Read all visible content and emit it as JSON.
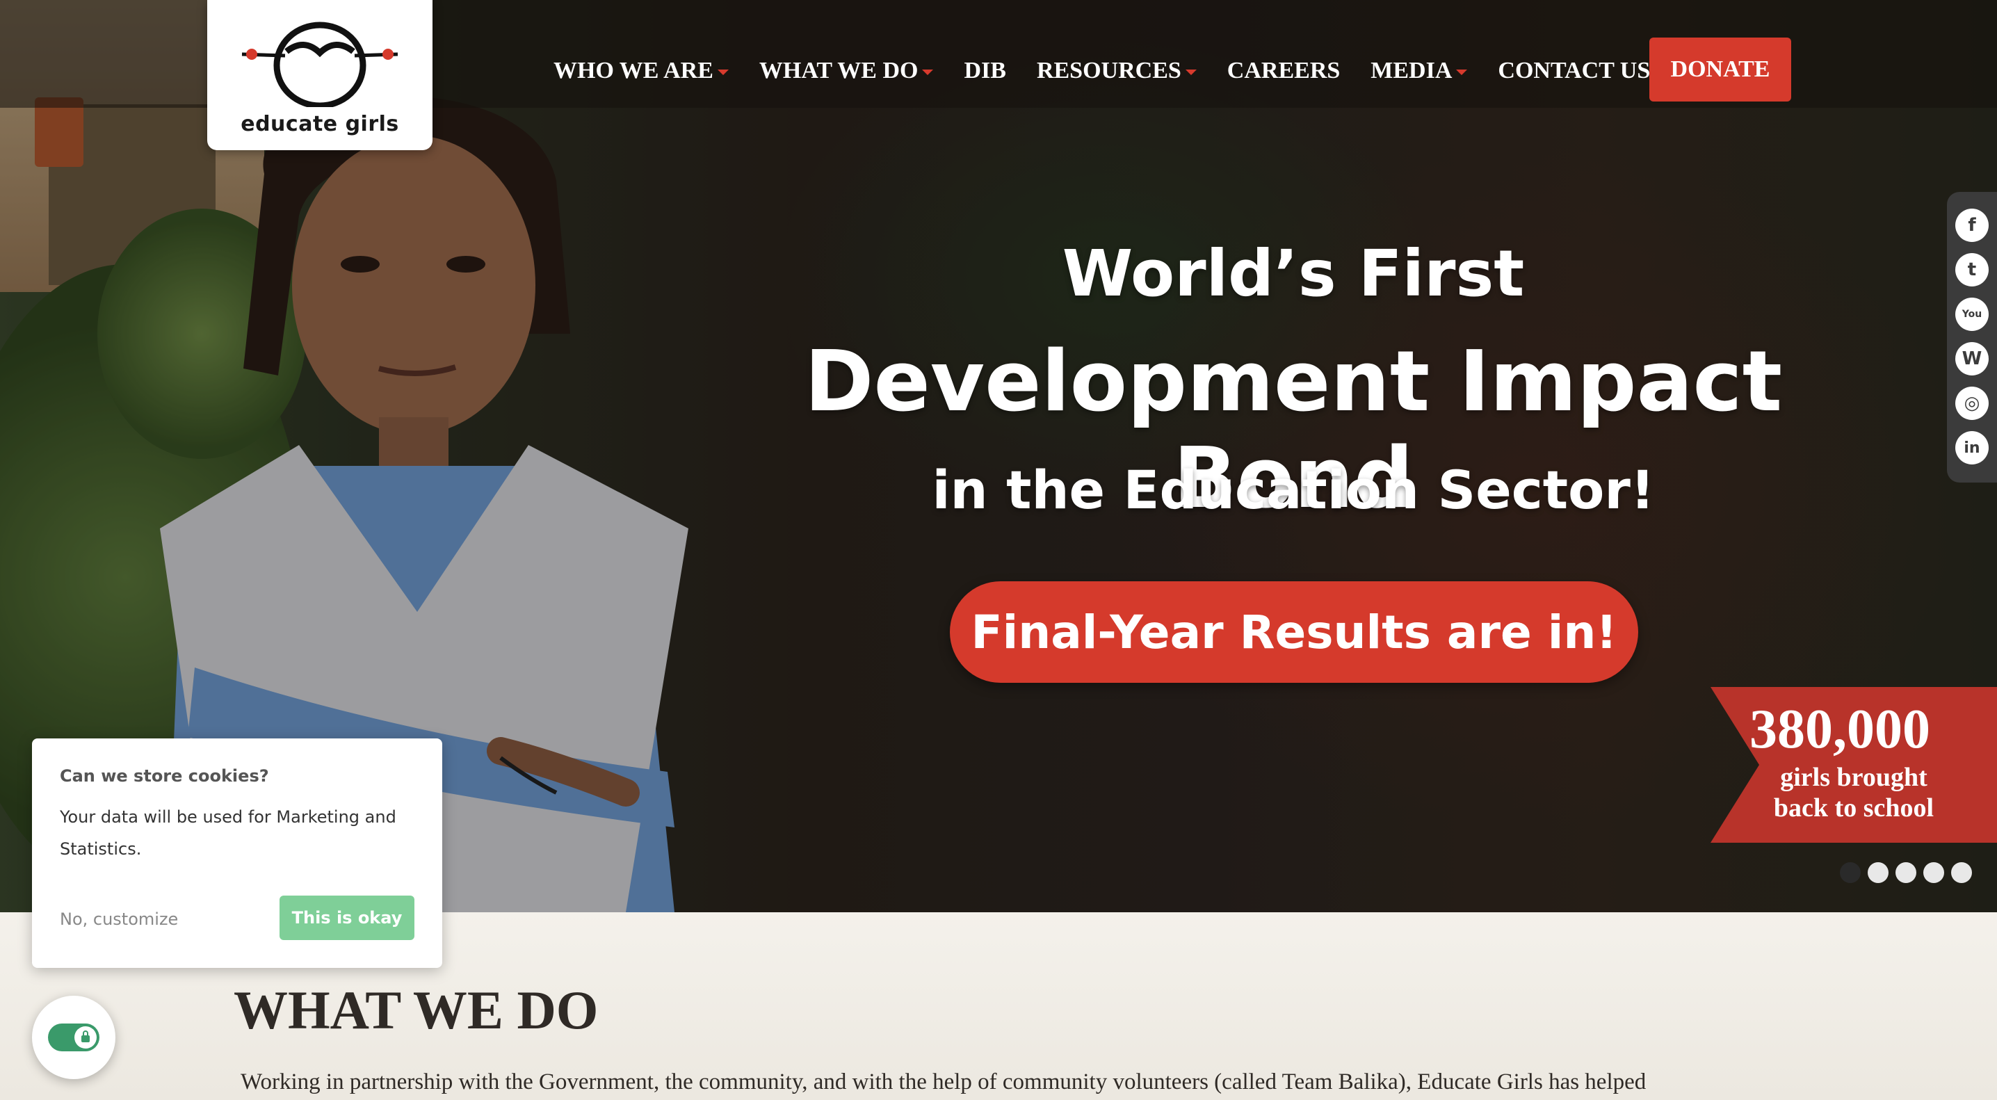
{
  "brand": {
    "name": "educate girls",
    "accent": "#d53a2c"
  },
  "nav": {
    "items": [
      {
        "label": "WHO WE ARE",
        "dropdown": true
      },
      {
        "label": "WHAT WE DO",
        "dropdown": true
      },
      {
        "label": "DIB",
        "dropdown": false
      },
      {
        "label": "RESOURCES",
        "dropdown": true
      },
      {
        "label": "CAREERS",
        "dropdown": false
      },
      {
        "label": "MEDIA",
        "dropdown": true
      },
      {
        "label": "CONTACT US",
        "dropdown": false
      }
    ],
    "donate_label": "DONATE"
  },
  "hero": {
    "line1": "World’s First",
    "line2": "Development Impact Bond",
    "line3": "in the Education Sector!",
    "cta_label": "Final-Year Results are in!",
    "stat_number": "380,000",
    "stat_caption_1": "girls brought",
    "stat_caption_2": "back to school",
    "slides_total": 5,
    "active_slide": 1
  },
  "social": {
    "icons": [
      "facebook-icon",
      "twitter-icon",
      "youtube-icon",
      "wordpress-icon",
      "instagram-icon",
      "linkedin-icon"
    ],
    "glyphs": [
      "f",
      "t",
      "You",
      "W",
      "◎",
      "in"
    ]
  },
  "cookie": {
    "title": "Can we store cookies?",
    "text": "Your data will be used for Marketing and Statistics.",
    "decline_label": "No, customize",
    "accept_label": "This is okay"
  },
  "section": {
    "title": "WHAT WE DO",
    "text": "Working in partnership with the Government, the community, and with the help of community volunteers (called Team Balika), Educate Girls has helped"
  }
}
